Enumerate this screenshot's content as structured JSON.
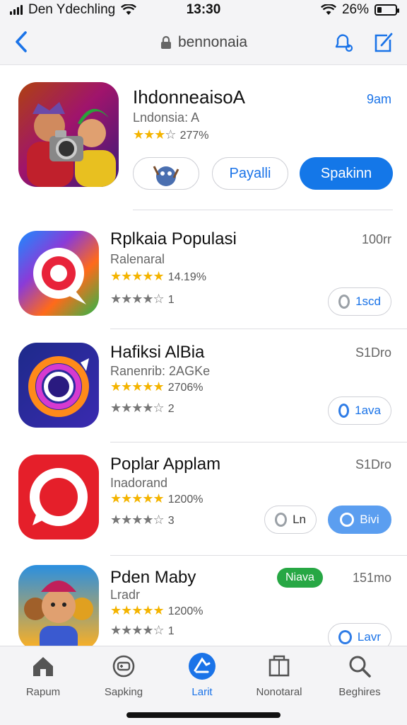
{
  "status_bar": {
    "carrier": "Den Ydechling",
    "time": "13:30",
    "battery": "26%",
    "battery_level": 0.26
  },
  "nav": {
    "title": "bennonaia"
  },
  "featured": {
    "name": "IhdonneaisoA",
    "subtitle": "Lndonsia: A",
    "rating": "277%",
    "stars": 3,
    "size": "9am",
    "buttons": {
      "middle": "Payalli",
      "primary": "Spakinn"
    }
  },
  "apps": [
    {
      "name": "Rplkaia Populasi",
      "subtitle": "Ralenaral",
      "rating": "14.19%",
      "stars_gold": 5,
      "rating2": "1",
      "stars2": 4,
      "size": "100rr",
      "action": "1scd"
    },
    {
      "name": "Hafiksi AlBia",
      "subtitle": "Ranenrib: 2AGKe",
      "rating": "2706%",
      "stars_gold": 5,
      "rating2": "2",
      "stars2": 4,
      "size": "S1Dro",
      "action": "1ava"
    },
    {
      "name": "Poplar Applam",
      "subtitle": "Inadorand",
      "rating": "1200%",
      "stars_gold": 5,
      "rating2": "3",
      "stars2": 4,
      "size": "S1Dro",
      "action_secondary": "Ln",
      "action": "Bivi"
    },
    {
      "name": "Pden Maby",
      "subtitle": "Lradr",
      "badge": "Niava",
      "rating": "1200%",
      "stars_gold": 5,
      "rating2": "1",
      "stars2": 4,
      "size": "151mo",
      "action": "Lavr"
    }
  ],
  "tabs": [
    {
      "label": "Rapum",
      "icon": "home-icon"
    },
    {
      "label": "Sapking",
      "icon": "games-icon"
    },
    {
      "label": "Larit",
      "icon": "apps-icon"
    },
    {
      "label": "Nonotaral",
      "icon": "arcade-icon"
    },
    {
      "label": "Beghires",
      "icon": "search-icon"
    }
  ],
  "colors": {
    "accent": "#1477e8",
    "star": "#f4b400",
    "badge": "#27a744"
  }
}
